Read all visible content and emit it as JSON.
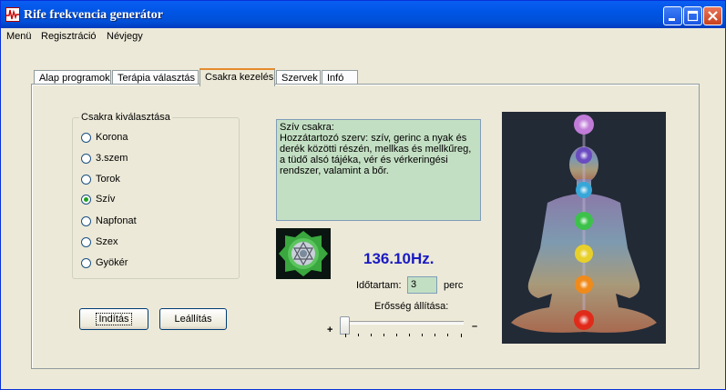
{
  "window": {
    "title": "Rife frekvencia generátor"
  },
  "menu": {
    "items": [
      "Menü",
      "Regisztráció",
      "Névjegy"
    ]
  },
  "tabs": [
    "Alap programok",
    "Terápia választás",
    "Csakra kezelés",
    "Szervek",
    "Infó"
  ],
  "active_tab": "Csakra kezelés",
  "chakra_group": {
    "legend": "Csakra kiválasztása",
    "options": [
      "Korona",
      "3.szem",
      "Torok",
      "Szív",
      "Napfonat",
      "Szex",
      "Gyökér"
    ],
    "selected": "Szív"
  },
  "buttons": {
    "start": "Indítás",
    "stop": "Leállítás"
  },
  "description": {
    "title": "Szív csakra:",
    "body": "Hozzátartozó szerv: szív, gerinc a nyak és derék közötti részén, mellkas és mellkűreg, a tüdő alsó tájéka, vér és vérkeringési rendszer, valamint a bőr."
  },
  "frequency": "136.10Hz.",
  "duration": {
    "label": "Időtartam:",
    "value": "3",
    "unit": "perc"
  },
  "strength": {
    "label": "Erősség állítása:",
    "plus": "+",
    "minus": "–",
    "level": 0
  },
  "icons": [
    "app-icon",
    "minimize-icon",
    "maximize-icon",
    "close-icon",
    "mandala-image",
    "chakra-figure-image"
  ],
  "colors": {
    "titlebar": "#0055e5",
    "textbox_bg": "#c3dfc3",
    "frequency": "#1a1ac2",
    "active_tab_accent": "#e68b2c"
  }
}
